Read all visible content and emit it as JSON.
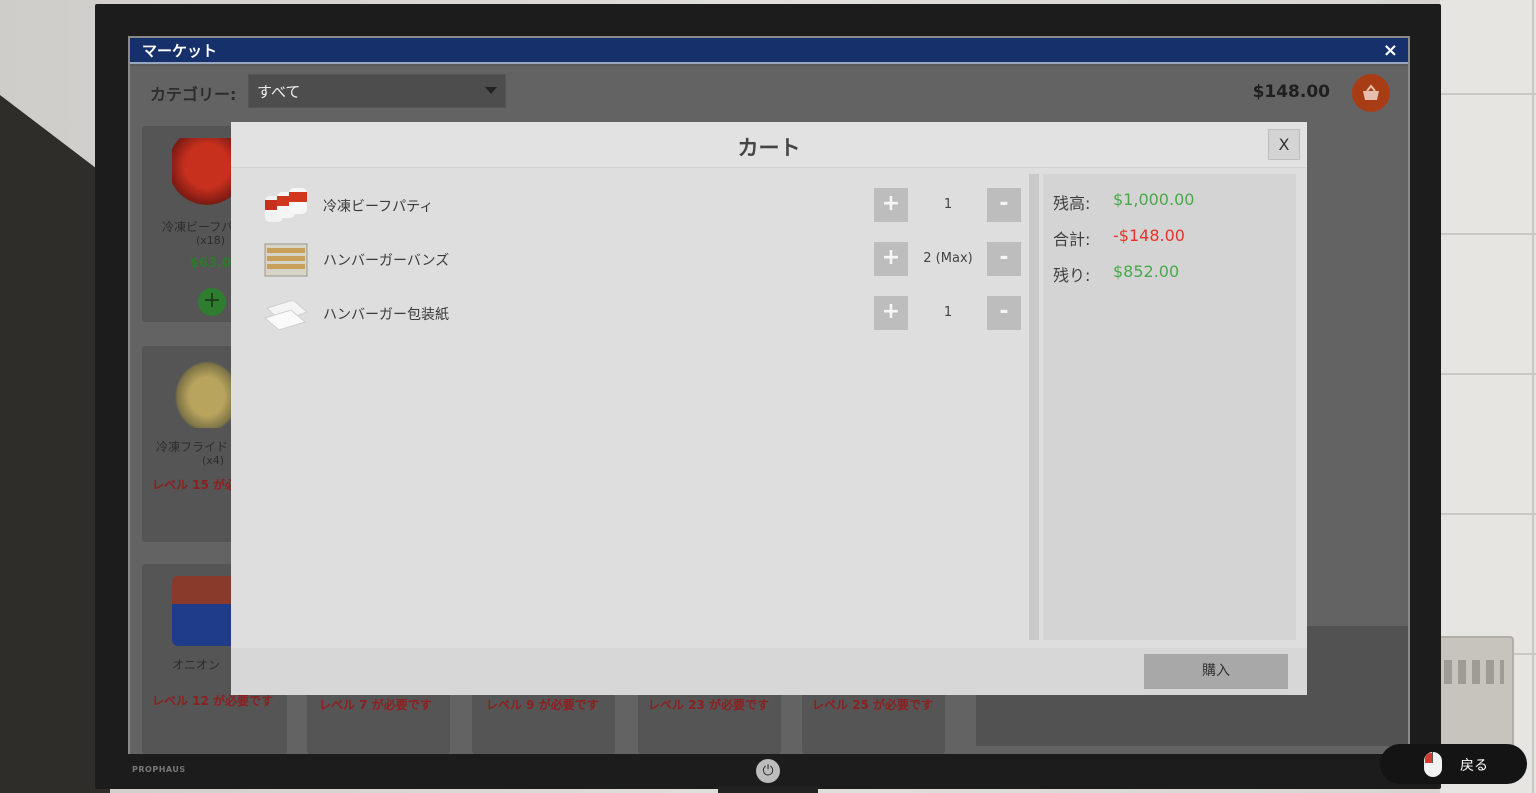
{
  "market": {
    "title": "マーケット",
    "close_icon": "×",
    "category_label": "カテゴリー:",
    "category_value": "すべて",
    "balance_display": "$148.00",
    "basket_icon": "basket-icon",
    "products": [
      {
        "name": "冷凍ビーフパ",
        "count": "(x18)",
        "price": "$63.0"
      },
      {
        "name": "冷凍フライド",
        "count": "(x4)",
        "lock": "レベル 15 が必"
      },
      {
        "name": "オニオン",
        "lock": "レベル 12 が必要です"
      }
    ],
    "bottom_locks": [
      "レベル 7 が必要です",
      "レベル 9 が必要です",
      "レベル 23 が必要です",
      "レベル 25 が必要です"
    ]
  },
  "cart": {
    "title": "カート",
    "close_label": "X",
    "items": [
      {
        "name": "冷凍ビーフパティ",
        "qty": "1"
      },
      {
        "name": "ハンバーガーバンズ",
        "qty": "2 (Max)"
      },
      {
        "name": "ハンバーガー包装紙",
        "qty": "1"
      }
    ],
    "plus_label": "+",
    "minus_label": "-",
    "summary": {
      "balance_label": "残高:",
      "balance_value": "$1,000.00",
      "total_label": "合計:",
      "total_value": "-$148.00",
      "remaining_label": "残り:",
      "remaining_value": "$852.00"
    },
    "buy_label": "購入"
  },
  "monitor": {
    "brand": "PROPHAUS"
  },
  "hint": {
    "back_label": "戻る"
  },
  "colors": {
    "titlebar": "#15306a",
    "positive": "#4aa84a",
    "negative": "#e8332a",
    "basket": "#a83c14"
  }
}
